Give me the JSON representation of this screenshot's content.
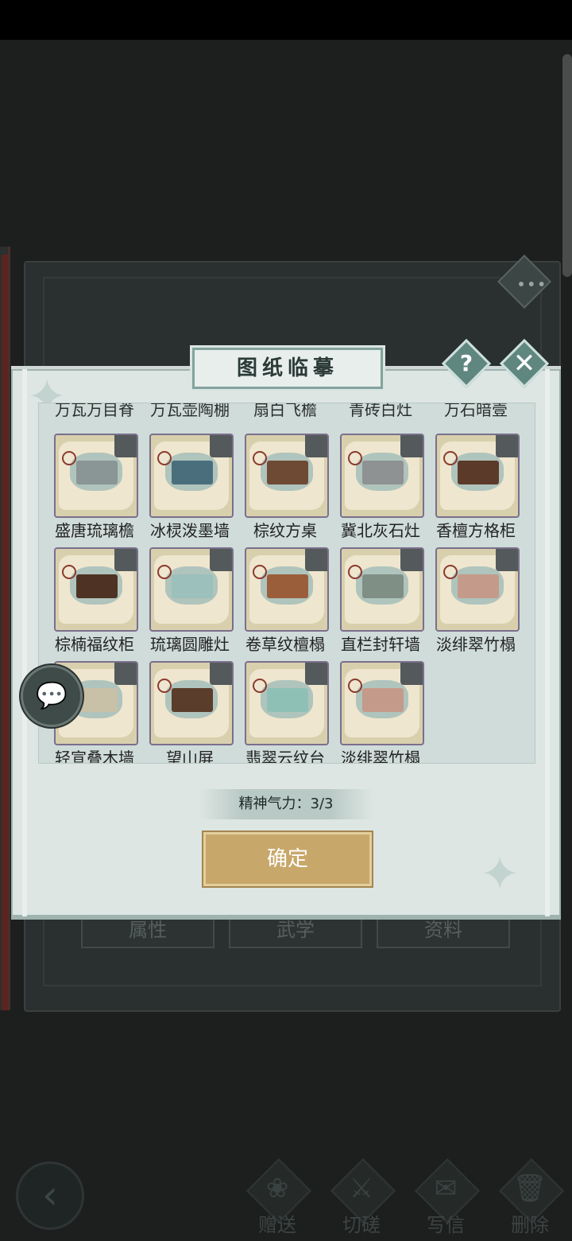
{
  "book": {
    "tabs": [
      "属性",
      "武学",
      "资料"
    ],
    "more_icon": "more-dots-icon"
  },
  "dialog": {
    "title": "图纸临摹",
    "help_icon": "question-icon",
    "close_icon": "close-icon",
    "cut_off_row": [
      "万瓦万目脊",
      "万瓦壶陶棚",
      "扇白飞檐",
      "青砖白灶",
      "万石暗壹"
    ],
    "items": [
      {
        "name": "盛唐琉璃檐",
        "color": "#8a9596"
      },
      {
        "name": "冰棂泼墨墙",
        "color": "#4b6e7c"
      },
      {
        "name": "棕纹方桌",
        "color": "#6e4a35"
      },
      {
        "name": "冀北灰石灶",
        "color": "#8e9292"
      },
      {
        "name": "香檀方格柜",
        "color": "#5c3a2a"
      },
      {
        "name": "棕楠福纹柜",
        "color": "#4e3325"
      },
      {
        "name": "琉璃圆雕灶",
        "color": "#9cc0bb"
      },
      {
        "name": "卷草纹檀榻",
        "color": "#9a5e3b"
      },
      {
        "name": "直栏封轩墙",
        "color": "#7f8f86"
      },
      {
        "name": "淡绯翠竹榻",
        "color": "#c49a8a"
      },
      {
        "name": "轻宣叠木墙",
        "color": "#c9c0a8"
      },
      {
        "name": "望山屏",
        "color": "#5a3d2a"
      },
      {
        "name": "翡翠云纹台",
        "color": "#8fc0b6"
      },
      {
        "name": "淡绯翠竹榻",
        "color": "#c49a8a"
      }
    ],
    "stamina": "精神气力：3/3",
    "confirm": "确定"
  },
  "actions": [
    {
      "label": "赠送",
      "icon": "gift-scroll-icon"
    },
    {
      "label": "切磋",
      "icon": "sword-icon"
    },
    {
      "label": "写信",
      "icon": "letter-icon"
    },
    {
      "label": "删除",
      "icon": "trash-icon"
    }
  ],
  "back_icon": "back-arrow-icon",
  "chat_icon": "chat-bubble-icon"
}
